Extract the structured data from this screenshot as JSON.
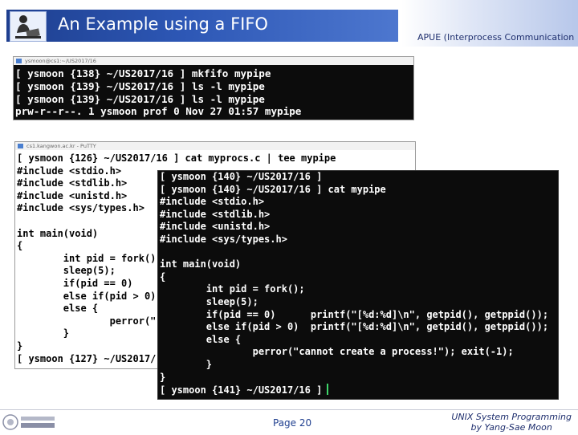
{
  "header": {
    "title": "An Example using a  FIFO",
    "right_text": "APUE (Interprocess Communication"
  },
  "terminal1": {
    "window_title": "ysmoon@cs1:~/US2017/16",
    "lines": [
      "[ ysmoon {138} ~/US2017/16 ] mkfifo mypipe",
      "[ ysmoon {139} ~/US2017/16 ] ls -l mypipe",
      "[ ysmoon {139} ~/US2017/16 ] ls -l mypipe",
      "prw-r--r--. 1 ysmoon prof 0 Nov 27 01:57 mypipe"
    ]
  },
  "terminal2": {
    "window_title": "cs1.kangwon.ac.kr - PuTTY",
    "lines": [
      "[ ysmoon {126} ~/US2017/16 ] cat myprocs.c | tee mypipe",
      "#include <stdio.h>",
      "#include <stdlib.h>",
      "#include <unistd.h>",
      "#include <sys/types.h>",
      "",
      "int main(void)",
      "{",
      "        int pid = fork();",
      "        sleep(5);",
      "        if(pid == 0)",
      "        else if(pid > 0)",
      "        else {",
      "                perror(\"",
      "        }",
      "}",
      "[ ysmoon {127} ~/US2017/"
    ]
  },
  "terminal3": {
    "lines": [
      "[ ysmoon {140} ~/US2017/16 ]",
      "[ ysmoon {140} ~/US2017/16 ] cat mypipe",
      "#include <stdio.h>",
      "#include <stdlib.h>",
      "#include <unistd.h>",
      "#include <sys/types.h>",
      "",
      "int main(void)",
      "{",
      "        int pid = fork();",
      "        sleep(5);",
      "        if(pid == 0)      printf(\"[%d:%d]\\n\", getpid(), getppid());",
      "        else if(pid > 0)  printf(\"[%d:%d]\\n\", getpid(), getppid());",
      "        else {",
      "                perror(\"cannot create a process!\"); exit(-1);",
      "        }",
      "}",
      "[ ysmoon {141} ~/US2017/16 ]"
    ]
  },
  "footer": {
    "page": "Page 20",
    "right_line1": "UNIX System Programming",
    "right_line2": "by Yang-Sae Moon"
  },
  "colors": {
    "title_bar": "#2d57b5",
    "terminal_bg": "#0c0c0c",
    "terminal_fg": "#ffffff",
    "cursor": "#3ed66a"
  },
  "icons": {
    "header_logo": "professor-with-laptop-icon",
    "footer_logo": "university-logo"
  }
}
